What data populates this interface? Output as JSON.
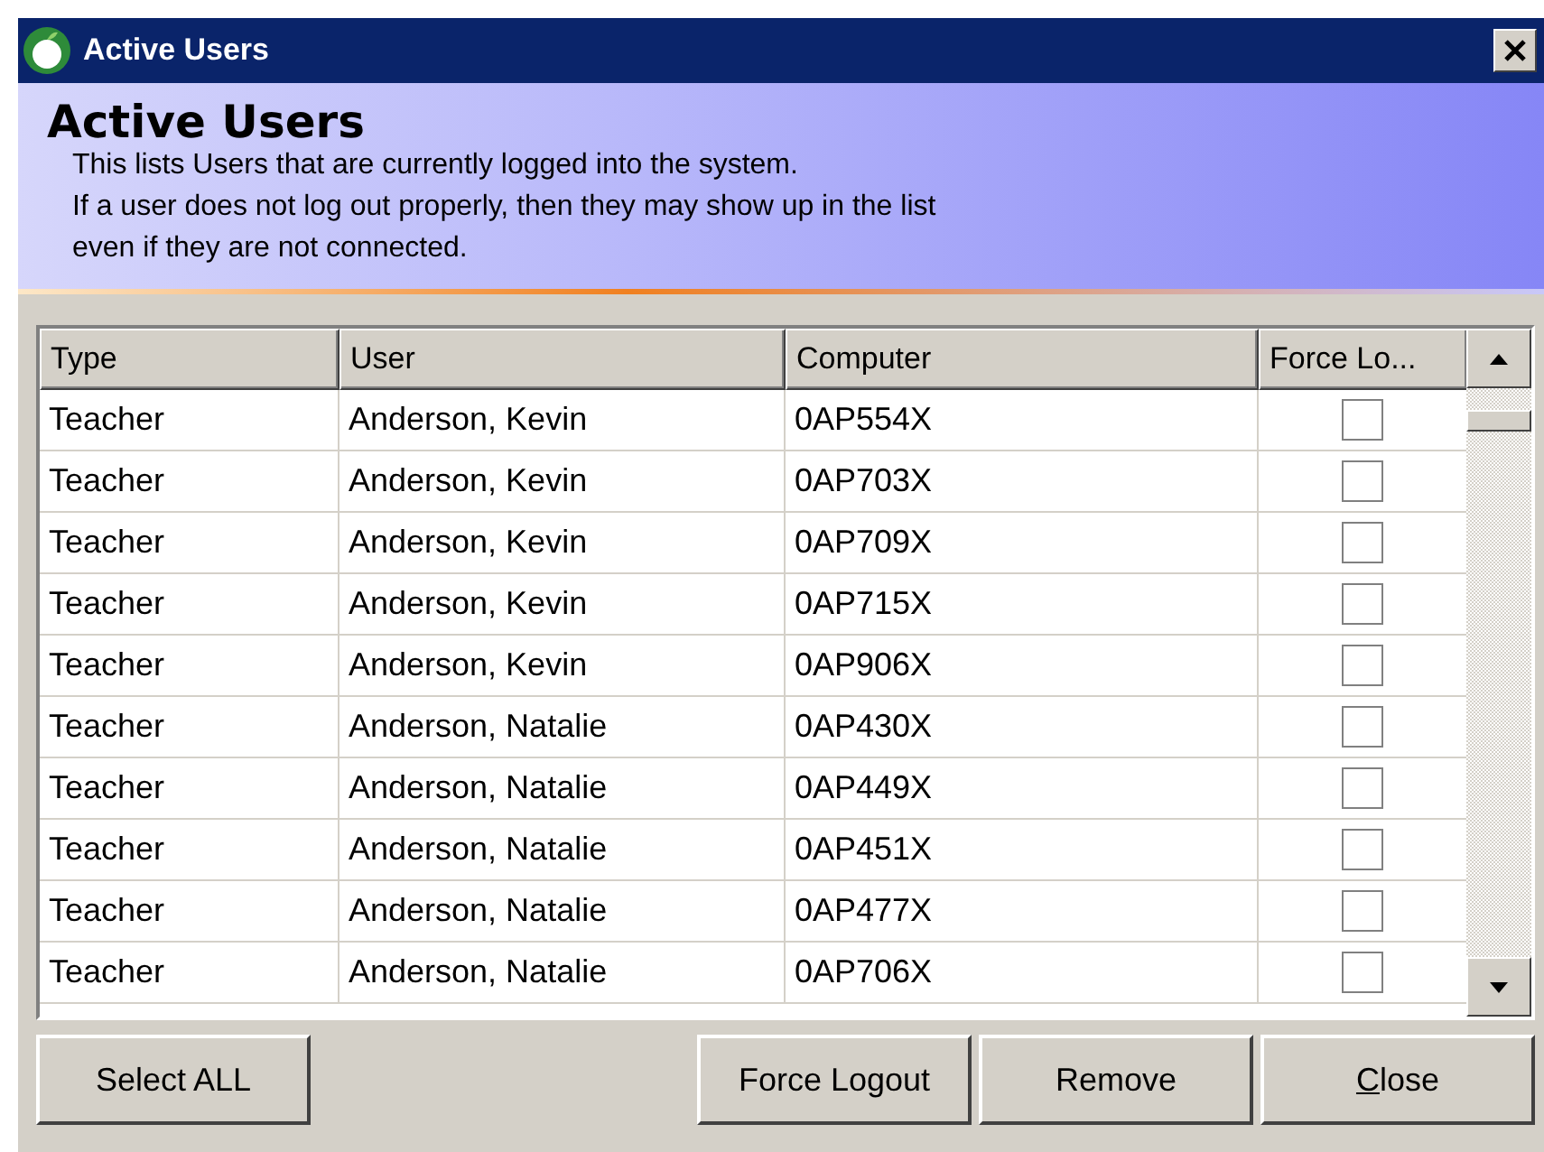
{
  "window": {
    "title": "Active Users"
  },
  "header": {
    "title": "Active Users",
    "lines": [
      "This lists Users that are currently logged into the system.",
      "If a user does not log out properly, then they may show up in the list",
      "even if they are not connected."
    ]
  },
  "table": {
    "columns": [
      "Type",
      "User",
      "Computer",
      "Force Lo..."
    ],
    "rows": [
      {
        "type": "Teacher",
        "user": "Anderson, Kevin",
        "computer": "0AP554X",
        "force_logout": false
      },
      {
        "type": "Teacher",
        "user": "Anderson, Kevin",
        "computer": "0AP703X",
        "force_logout": false
      },
      {
        "type": "Teacher",
        "user": "Anderson, Kevin",
        "computer": "0AP709X",
        "force_logout": false
      },
      {
        "type": "Teacher",
        "user": "Anderson, Kevin",
        "computer": "0AP715X",
        "force_logout": false
      },
      {
        "type": "Teacher",
        "user": "Anderson, Kevin",
        "computer": "0AP906X",
        "force_logout": false
      },
      {
        "type": "Teacher",
        "user": "Anderson, Natalie",
        "computer": "0AP430X",
        "force_logout": false
      },
      {
        "type": "Teacher",
        "user": "Anderson, Natalie",
        "computer": "0AP449X",
        "force_logout": false
      },
      {
        "type": "Teacher",
        "user": "Anderson, Natalie",
        "computer": "0AP451X",
        "force_logout": false
      },
      {
        "type": "Teacher",
        "user": "Anderson, Natalie",
        "computer": "0AP477X",
        "force_logout": false
      },
      {
        "type": "Teacher",
        "user": "Anderson, Natalie",
        "computer": "0AP706X",
        "force_logout": false
      }
    ]
  },
  "left_buttons": [
    {
      "label": "Select ALL",
      "mnemonic": false
    }
  ],
  "right_buttons": [
    {
      "label": "Force Logout",
      "mnemonic": false
    },
    {
      "label": "Remove",
      "mnemonic": false
    },
    {
      "label": "Close",
      "mnemonic": true
    }
  ]
}
